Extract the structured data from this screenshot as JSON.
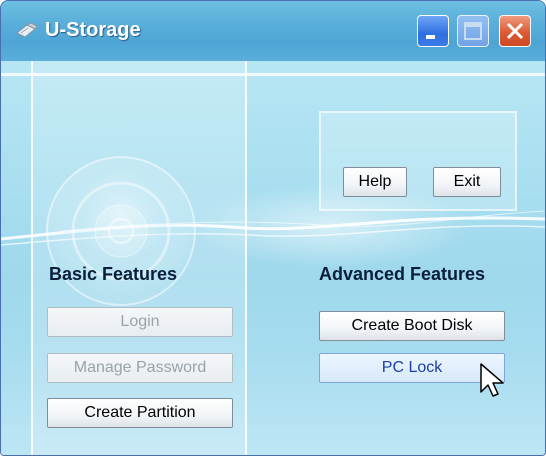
{
  "window": {
    "title": "U-Storage"
  },
  "titlebar_buttons": {
    "minimize": "minimize-icon",
    "maximize": "maximize-icon",
    "close": "close-icon"
  },
  "top_buttons": {
    "help": "Help",
    "exit": "Exit"
  },
  "basic": {
    "title": "Basic Features",
    "login": "Login",
    "manage_password": "Manage Password",
    "create_partition": "Create Partition"
  },
  "advanced": {
    "title": "Advanced Features",
    "create_boot_disk": "Create Boot Disk",
    "pc_lock": "PC Lock"
  },
  "colors": {
    "titlebar": "#5ab0da",
    "background": "#a9dff0",
    "disabled_text": "#9aa3aa",
    "hover_text": "#1a3fa8",
    "close_button": "#dc5a35"
  }
}
